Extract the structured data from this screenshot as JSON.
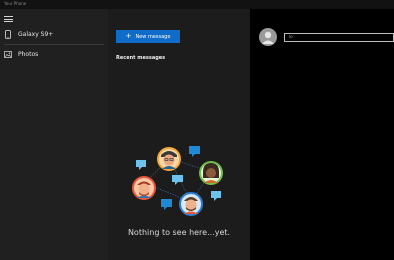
{
  "window": {
    "title": "Your Phone"
  },
  "sidebar": {
    "menu_icon": "hamburger-menu-icon",
    "items": [
      {
        "label": "Galaxy S9+",
        "icon": "phone-icon"
      },
      {
        "label": "Photos",
        "icon": "photos-icon"
      }
    ]
  },
  "messages": {
    "new_message_label": "New message",
    "new_message_icon": "plus-icon",
    "recent_heading": "Recent messages",
    "empty_state_text": "Nothing to see here...yet."
  },
  "compose": {
    "to_placeholder": "To",
    "to_value": ""
  },
  "colors": {
    "accent": "#0f6cc8",
    "sidebar_bg": "#202020",
    "list_bg": "#1c1c1c",
    "compose_bg": "#000000"
  }
}
